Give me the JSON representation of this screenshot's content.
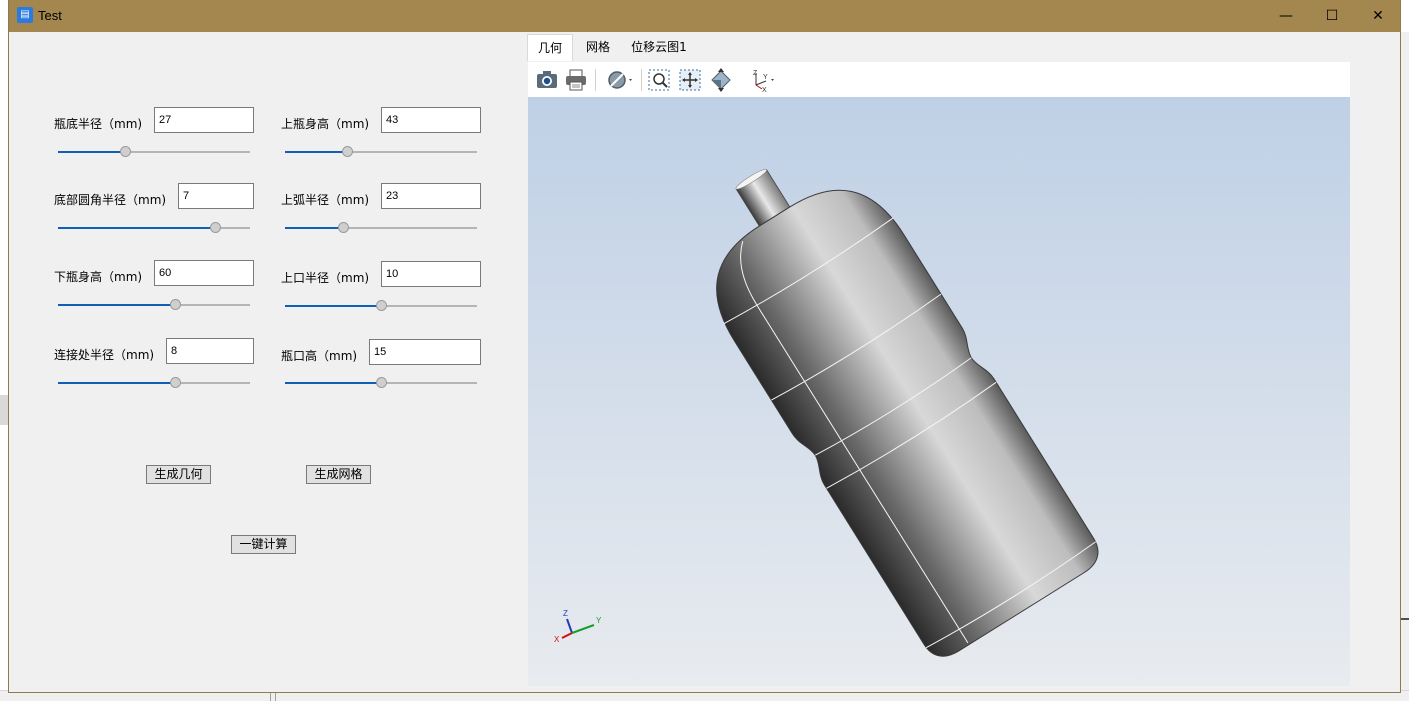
{
  "window": {
    "title": "Test",
    "min": "—",
    "max": "☐",
    "close": "✕",
    "icon": "app-cube-icon"
  },
  "params": [
    {
      "label": "瓶底半径（mm)",
      "value": "27",
      "pos": 0.35
    },
    {
      "label": "上瓶身高（mm)",
      "value": "43",
      "pos": 0.325
    },
    {
      "label": "底部圆角半径（mm)",
      "value": "7",
      "pos": 0.82
    },
    {
      "label": "上弧半径（mm)",
      "value": "23",
      "pos": 0.3
    },
    {
      "label": "下瓶身高（mm)",
      "value": "60",
      "pos": 0.61
    },
    {
      "label": "上口半径（mm)",
      "value": "10",
      "pos": 0.5
    },
    {
      "label": "连接处半径（mm)",
      "value": "8",
      "pos": 0.61
    },
    {
      "label": "瓶口高（mm)",
      "value": "15",
      "pos": 0.5
    }
  ],
  "buttons": {
    "gen_geometry": "生成几何",
    "gen_mesh": "生成网格",
    "one_click": "一键计算"
  },
  "tabs": [
    {
      "label": "几何",
      "active": true
    },
    {
      "label": "网格",
      "active": false
    },
    {
      "label": "位移云图1",
      "active": false
    }
  ],
  "toolbar": [
    "camera-icon",
    "print-icon",
    "clip-plane-icon",
    "zoom-window-icon",
    "fit-all-icon",
    "view-orient-icon",
    "axes-triad-icon"
  ],
  "axes": {
    "z": "Z",
    "y": "Y",
    "x": "X"
  },
  "colors": {
    "title_bar": "#a3874f",
    "slider_fill": "#0f5fb5",
    "viewport_top": "#bfd0e6",
    "viewport_bottom": "#e8ebef"
  }
}
